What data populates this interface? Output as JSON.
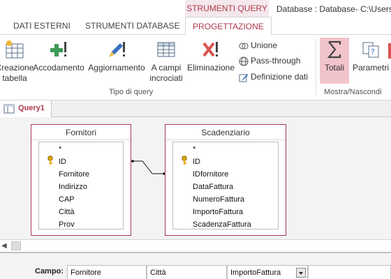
{
  "window": {
    "context_tab": "STRUMENTI QUERY",
    "title": "Database : Database- C:\\Users\\"
  },
  "ribbon_tabs": [
    "DATI ESTERNI",
    "STRUMENTI DATABASE",
    "PROGETTAZIONE"
  ],
  "ribbon": {
    "query_type_group": {
      "label": "Tipo di query",
      "buttons": [
        {
          "line1": "Creazione",
          "line2": "tabella",
          "icon": "make-table-icon"
        },
        {
          "line1": "Accodamento",
          "line2": "",
          "icon": "append-icon"
        },
        {
          "line1": "Aggiornamento",
          "line2": "",
          "icon": "update-icon"
        },
        {
          "line1": "A campi",
          "line2": "incrociati",
          "icon": "crosstab-icon"
        },
        {
          "line1": "Eliminazione",
          "line2": "",
          "icon": "delete-icon"
        }
      ],
      "small_buttons": [
        {
          "label": "Unione",
          "icon": "union-icon"
        },
        {
          "label": "Pass-through",
          "icon": "globe-icon"
        },
        {
          "label": "Definizione dati",
          "icon": "data-definition-icon"
        }
      ]
    },
    "show_hide_group": {
      "label": "Mostra/Nascondi",
      "buttons": [
        {
          "label": "Totali",
          "icon": "sigma-icon",
          "active": true
        },
        {
          "label": "Parametri",
          "icon": "parameters-icon"
        }
      ]
    }
  },
  "document_tab": "Query1",
  "tables": [
    {
      "name": "Fornitori",
      "fields": [
        "*",
        "ID",
        "Fornitore",
        "Indirizzo",
        "CAP",
        "Città",
        "Prov"
      ],
      "key_field": "ID"
    },
    {
      "name": "Scadenziario",
      "fields": [
        "*",
        "ID",
        "IDfornitore",
        "DataFattura",
        "NumeroFattura",
        "ImportoFattura",
        "ScadenzaFattura"
      ],
      "key_field": "ID"
    }
  ],
  "query_grid": {
    "row_label": "Campo:",
    "fields": [
      "Fornitore",
      "Città",
      "ImportoFattura",
      ""
    ]
  },
  "colors": {
    "accent": "#b0384d",
    "active_button": "#f2c4cc"
  }
}
